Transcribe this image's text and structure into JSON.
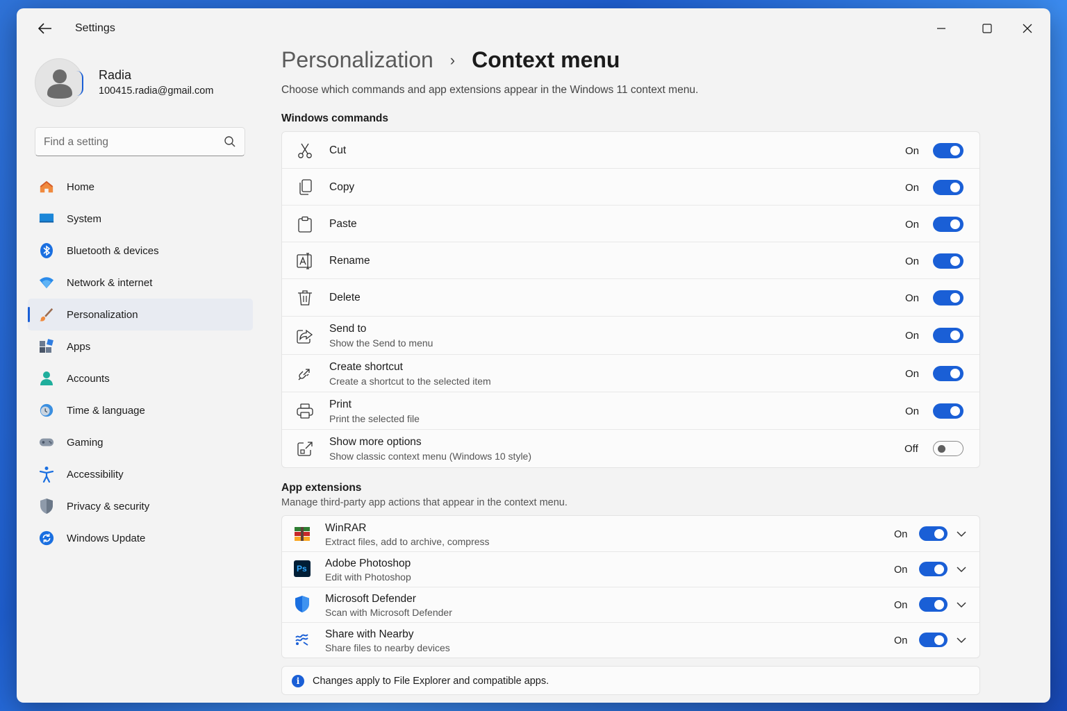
{
  "window": {
    "title": "Settings"
  },
  "user": {
    "name": "Radia",
    "email": "100415.radia@gmail.com"
  },
  "search": {
    "placeholder": "Find a setting"
  },
  "nav": [
    {
      "label": "Home",
      "icon": "home-icon"
    },
    {
      "label": "System",
      "icon": "system-icon"
    },
    {
      "label": "Bluetooth & devices",
      "icon": "bluetooth-icon"
    },
    {
      "label": "Network & internet",
      "icon": "network-icon"
    },
    {
      "label": "Personalization",
      "icon": "personalization-icon",
      "active": true
    },
    {
      "label": "Apps",
      "icon": "apps-icon"
    },
    {
      "label": "Accounts",
      "icon": "accounts-icon"
    },
    {
      "label": "Time & language",
      "icon": "time-language-icon"
    },
    {
      "label": "Gaming",
      "icon": "gaming-icon"
    },
    {
      "label": "Accessibility",
      "icon": "accessibility-icon"
    },
    {
      "label": "Privacy & security",
      "icon": "privacy-icon"
    },
    {
      "label": "Windows Update",
      "icon": "windows-update-icon"
    }
  ],
  "breadcrumb": {
    "parent": "Personalization",
    "separator": "›",
    "current": "Context menu"
  },
  "page": {
    "subtitle": "Choose which commands and app extensions appear in the Windows 11 context menu."
  },
  "windows_commands": {
    "title": "Windows commands",
    "items": [
      {
        "title": "Cut",
        "subtitle": "",
        "state": "On",
        "on": true,
        "icon": "scissors-icon"
      },
      {
        "title": "Copy",
        "subtitle": "",
        "state": "On",
        "on": true,
        "icon": "copy-icon"
      },
      {
        "title": "Paste",
        "subtitle": "",
        "state": "On",
        "on": true,
        "icon": "clipboard-icon"
      },
      {
        "title": "Rename",
        "subtitle": "",
        "state": "On",
        "on": true,
        "icon": "rename-icon"
      },
      {
        "title": "Delete",
        "subtitle": "",
        "state": "On",
        "on": true,
        "icon": "trash-icon"
      },
      {
        "title": "Send to",
        "subtitle": "Show the Send to menu",
        "state": "On",
        "on": true,
        "icon": "share-icon"
      },
      {
        "title": "Create shortcut",
        "subtitle": "Create a shortcut to the selected item",
        "state": "On",
        "on": true,
        "icon": "link-icon"
      },
      {
        "title": "Print",
        "subtitle": "Print the selected file",
        "state": "On",
        "on": true,
        "icon": "printer-icon"
      },
      {
        "title": "Show more options",
        "subtitle": "Show classic context menu (Windows 10 style)",
        "state": "Off",
        "on": false,
        "icon": "expand-icon"
      }
    ]
  },
  "app_extensions": {
    "title": "App extensions",
    "description": "Manage third-party app actions that appear in the context menu.",
    "items": [
      {
        "title": "WinRAR",
        "subtitle": "Extract files, add to archive, compress",
        "state": "On",
        "on": true,
        "icon": "winrar-icon"
      },
      {
        "title": "Adobe Photoshop",
        "subtitle": "Edit with Photoshop",
        "state": "On",
        "on": true,
        "icon": "photoshop-icon",
        "icon_text": "Ps"
      },
      {
        "title": "Microsoft Defender",
        "subtitle": "Scan with Microsoft Defender",
        "state": "On",
        "on": true,
        "icon": "defender-icon"
      },
      {
        "title": "Share with Nearby",
        "subtitle": "Share files to nearby devices",
        "state": "On",
        "on": true,
        "icon": "nearby-share-icon"
      }
    ]
  },
  "info": {
    "text": "Changes apply to File Explorer and compatible apps.",
    "icon_text": "i"
  },
  "colors": {
    "accent": "#1a5fd6",
    "window_bg": "#f3f3f3",
    "card_bg": "#fbfbfb"
  }
}
